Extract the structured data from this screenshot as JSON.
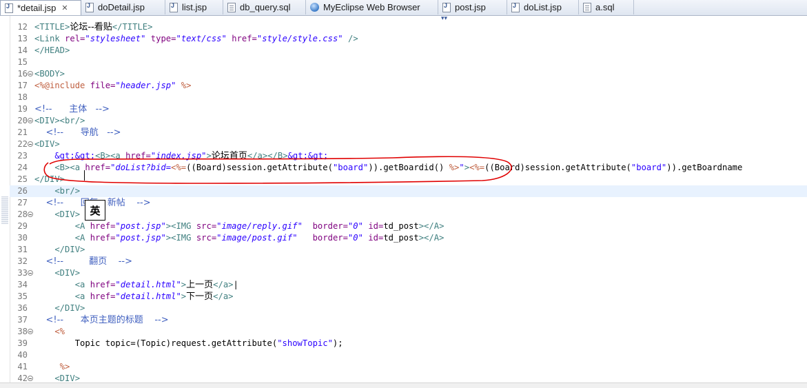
{
  "tabs": [
    {
      "label": "*detail.jsp",
      "icon": "jsp-file-icon",
      "active": true
    },
    {
      "label": "doDetail.jsp",
      "icon": "jsp-file-icon"
    },
    {
      "label": "list.jsp",
      "icon": "jsp-file-icon"
    },
    {
      "label": "db_query.sql",
      "icon": "sql-file-icon"
    },
    {
      "label": "MyEclipse Web Browser",
      "icon": "globe-icon"
    },
    {
      "label": "post.jsp",
      "icon": "jsp-file-icon"
    },
    {
      "label": "doList.jsp",
      "icon": "jsp-file-icon"
    },
    {
      "label": "a.sql",
      "icon": "sql-file-icon"
    }
  ],
  "tab_close_glyph": "✕",
  "tab_menu_glyph": "▾▾",
  "ime_indicator": "英",
  "annotation_color": "#e00000",
  "lines": [
    {
      "n": "12",
      "fold": false,
      "segs": [
        [
          "tag",
          "<TITLE>"
        ],
        [
          "txt",
          "论坛--看贴"
        ],
        [
          "tag",
          "</TITLE>"
        ]
      ]
    },
    {
      "n": "13",
      "fold": false,
      "segs": [
        [
          "tag",
          "<Link "
        ],
        [
          "attr",
          "rel="
        ],
        [
          "str",
          "\"stylesheet\""
        ],
        [
          "attr",
          " type="
        ],
        [
          "str",
          "\"text/css\""
        ],
        [
          "attr",
          " href="
        ],
        [
          "str",
          "\"style/style.css\""
        ],
        [
          "tag",
          " />"
        ]
      ]
    },
    {
      "n": "14",
      "fold": false,
      "segs": [
        [
          "tag",
          "</HEAD>"
        ]
      ]
    },
    {
      "n": "15",
      "fold": false,
      "segs": []
    },
    {
      "n": "16",
      "fold": true,
      "segs": [
        [
          "tag",
          "<BODY>"
        ]
      ]
    },
    {
      "n": "17",
      "fold": false,
      "segs": [
        [
          "jsp",
          "<%@include "
        ],
        [
          "attr",
          "file="
        ],
        [
          "str",
          "\"header.jsp\""
        ],
        [
          "jsp",
          " %>"
        ]
      ]
    },
    {
      "n": "18",
      "fold": false,
      "segs": []
    },
    {
      "n": "19",
      "fold": false,
      "segs": [
        [
          "cmt",
          "<!--      主体   -->"
        ]
      ]
    },
    {
      "n": "20",
      "fold": true,
      "segs": [
        [
          "tag",
          "<DIV><br/>"
        ]
      ]
    },
    {
      "n": "21",
      "fold": false,
      "segs": [
        [
          "cmt",
          "    <!--      导航   -->"
        ]
      ]
    },
    {
      "n": "22",
      "fold": true,
      "segs": [
        [
          "tag",
          "<DIV>"
        ]
      ]
    },
    {
      "n": "23",
      "fold": false,
      "segs": [
        [
          "ent",
          "    &gt;&gt;"
        ],
        [
          "tag",
          "<B><a "
        ],
        [
          "attr",
          "href="
        ],
        [
          "str",
          "\"index.jsp\""
        ],
        [
          "tag",
          ">"
        ],
        [
          "txt",
          "论坛首页"
        ],
        [
          "tag",
          "</a></B>"
        ],
        [
          "ent",
          "&gt;&gt;"
        ]
      ]
    },
    {
      "n": "24",
      "fold": false,
      "segs": [
        [
          "tag",
          "    <B><a "
        ],
        [
          "attr",
          "href="
        ],
        [
          "str",
          "\"doList?bid="
        ],
        [
          "jsp",
          "<%="
        ],
        [
          "txt",
          "((Board)session.getAttribute("
        ],
        [
          "ent",
          "\"board\""
        ],
        [
          "txt",
          ")).getBoardid() "
        ],
        [
          "jsp",
          "%>"
        ],
        [
          "str",
          "\""
        ],
        [
          "tag",
          ">"
        ],
        [
          "jsp",
          "<%="
        ],
        [
          "txt",
          "((Board)session.getAttribute("
        ],
        [
          "ent",
          "\"board\""
        ],
        [
          "txt",
          ")).getBoardname"
        ]
      ]
    },
    {
      "n": "25",
      "fold": false,
      "segs": [
        [
          "tag",
          "</DIV>"
        ]
      ]
    },
    {
      "n": "26",
      "fold": false,
      "cur": true,
      "segs": [
        [
          "tag",
          "    <br/>"
        ]
      ]
    },
    {
      "n": "27",
      "fold": false,
      "segs": [
        [
          "cmt",
          "    <!--      回复、新帖    -->"
        ]
      ]
    },
    {
      "n": "28",
      "fold": true,
      "segs": [
        [
          "tag",
          "    <DIV>"
        ]
      ]
    },
    {
      "n": "29",
      "fold": false,
      "segs": [
        [
          "tag",
          "        <A "
        ],
        [
          "attr",
          "href="
        ],
        [
          "str",
          "\"post.jsp\""
        ],
        [
          "tag",
          ">"
        ],
        [
          "tag",
          "<IMG "
        ],
        [
          "attr",
          "src="
        ],
        [
          "str",
          "\"image/reply.gif\""
        ],
        [
          "attr",
          "  border="
        ],
        [
          "str",
          "\"0\""
        ],
        [
          "attr",
          " id="
        ],
        [
          "txt",
          "td_post"
        ],
        [
          "tag",
          "></A>"
        ]
      ]
    },
    {
      "n": "30",
      "fold": false,
      "segs": [
        [
          "tag",
          "        <A "
        ],
        [
          "attr",
          "href="
        ],
        [
          "str",
          "\"post.jsp\""
        ],
        [
          "tag",
          ">"
        ],
        [
          "tag",
          "<IMG "
        ],
        [
          "attr",
          "src="
        ],
        [
          "str",
          "\"image/post.gif\""
        ],
        [
          "attr",
          "   border="
        ],
        [
          "str",
          "\"0\""
        ],
        [
          "attr",
          " id="
        ],
        [
          "txt",
          "td_post"
        ],
        [
          "tag",
          "></A>"
        ]
      ]
    },
    {
      "n": "31",
      "fold": false,
      "segs": [
        [
          "tag",
          "    </DIV>"
        ]
      ]
    },
    {
      "n": "32",
      "fold": false,
      "segs": [
        [
          "cmt",
          "    <!--         翻页    -->"
        ]
      ]
    },
    {
      "n": "33",
      "fold": true,
      "segs": [
        [
          "tag",
          "    <DIV>"
        ]
      ]
    },
    {
      "n": "34",
      "fold": false,
      "segs": [
        [
          "tag",
          "        <a "
        ],
        [
          "attr",
          "href="
        ],
        [
          "str",
          "\"detail.html\""
        ],
        [
          "tag",
          ">"
        ],
        [
          "txt",
          "上一页"
        ],
        [
          "tag",
          "</a>"
        ],
        [
          "txt",
          "|"
        ]
      ]
    },
    {
      "n": "35",
      "fold": false,
      "segs": [
        [
          "tag",
          "        <a "
        ],
        [
          "attr",
          "href="
        ],
        [
          "str",
          "\"detail.html\""
        ],
        [
          "tag",
          ">"
        ],
        [
          "txt",
          "下一页"
        ],
        [
          "tag",
          "</a>"
        ]
      ]
    },
    {
      "n": "36",
      "fold": false,
      "segs": [
        [
          "tag",
          "    </DIV>"
        ]
      ]
    },
    {
      "n": "37",
      "fold": false,
      "segs": [
        [
          "cmt",
          "    <!--      本页主题的标题    -->"
        ]
      ]
    },
    {
      "n": "38",
      "fold": true,
      "segs": [
        [
          "jsp",
          "    <%"
        ]
      ]
    },
    {
      "n": "39",
      "fold": false,
      "segs": [
        [
          "txt",
          "        Topic topic=(Topic)request.getAttribute("
        ],
        [
          "ent",
          "\"showTopic\""
        ],
        [
          "txt",
          ");"
        ]
      ]
    },
    {
      "n": "40",
      "fold": false,
      "segs": []
    },
    {
      "n": "41",
      "fold": false,
      "segs": [
        [
          "jsp",
          "     %>"
        ]
      ]
    },
    {
      "n": "42",
      "fold": true,
      "segs": [
        [
          "tag",
          "    <DIV>"
        ]
      ]
    }
  ]
}
